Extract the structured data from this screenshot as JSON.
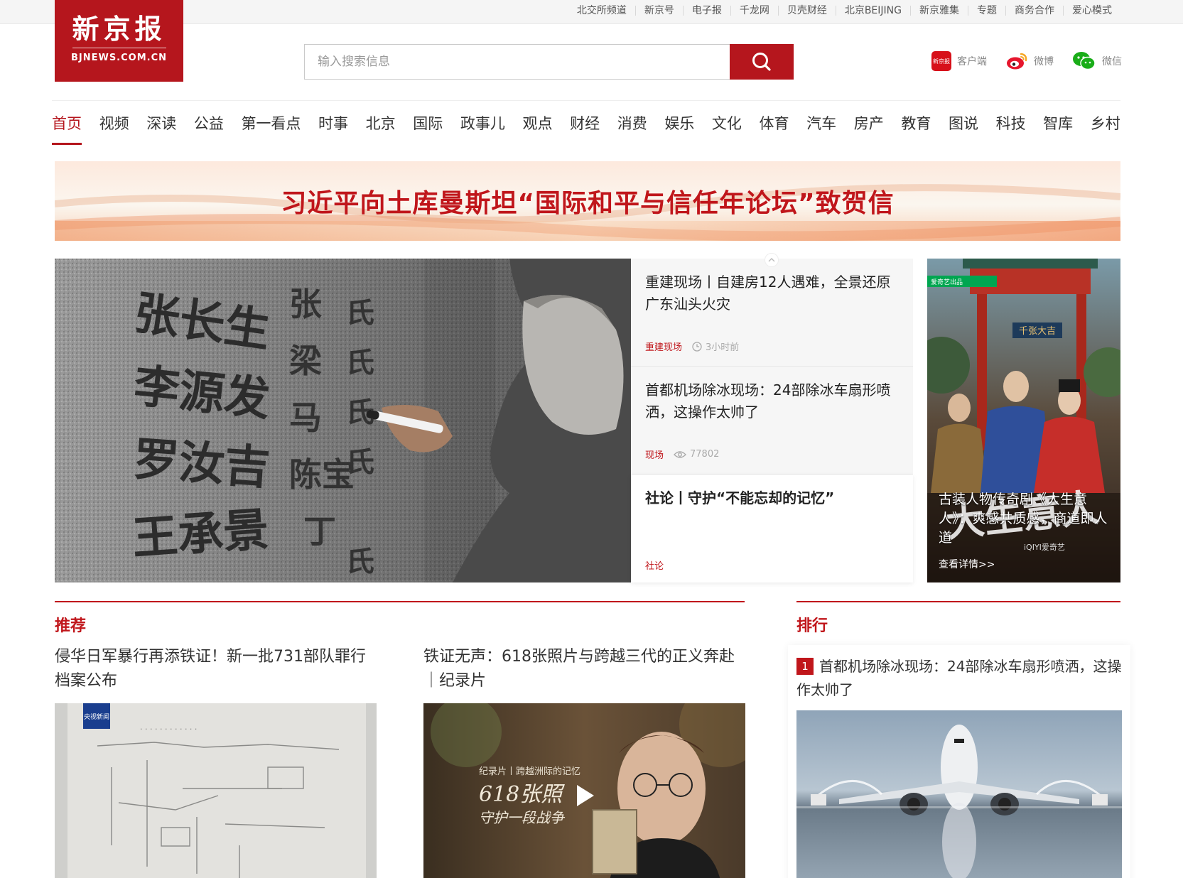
{
  "top_links": [
    "北交所频道",
    "新京号",
    "电子报",
    "千龙网",
    "贝壳财经",
    "北京BEIJING",
    "新京雅集",
    "专题",
    "商务合作",
    "爱心模式"
  ],
  "logo": {
    "cn": "新京报",
    "en": "BJNEWS.COM.CN"
  },
  "search": {
    "placeholder": "输入搜索信息"
  },
  "social": {
    "app_icon_text": "新京报",
    "app_label": "客户端",
    "weibo_label": "微博",
    "wechat_label": "微信"
  },
  "nav": [
    "首页",
    "视频",
    "深读",
    "公益",
    "第一看点",
    "时事",
    "北京",
    "国际",
    "政事儿",
    "观点",
    "财经",
    "消费",
    "娱乐",
    "文化",
    "体育",
    "汽车",
    "房产",
    "教育",
    "图说",
    "科技",
    "智库",
    "乡村"
  ],
  "banner": {
    "text": "习近平向土库曼斯坦“国际和平与信任年论坛”致贺信"
  },
  "hero": {
    "image_text": {
      "col1": [
        "张长生",
        "李源发",
        "罗汝吉",
        "王承景"
      ],
      "col2": [
        "张",
        "梁",
        "马",
        "陈宝",
        "丁"
      ],
      "col3": [
        "氏",
        "氏",
        "氏",
        "氏",
        "氏"
      ]
    },
    "items": [
      {
        "title": "重建现场丨自建房12人遇难，全景还原广东汕头火灾",
        "tag": "重建现场",
        "info": "3小时前"
      },
      {
        "title": "首都机场除冰现场：24部除冰车扇形喷洒，这操作太帅了",
        "tag": "现场",
        "info": "77802"
      },
      {
        "title": "社论丨守护“不能忘却的记忆”",
        "tag": "社论",
        "info": ""
      }
    ]
  },
  "side_poster": {
    "caption": "古装人物传奇剧《大生意人》：爽感共质感，商道即人道",
    "more": "查看详情>>",
    "badge": "爱奇艺出品",
    "plaque": "千张大吉",
    "art_title": "大生意人",
    "brand": "iQIYI爱奇艺"
  },
  "recommend": {
    "title": "推荐",
    "items": [
      {
        "title": "侵华日军暴行再添铁证！新一批731部队罪行档案公布",
        "badge": "央视新闻"
      },
      {
        "title": "铁证无声：618张照片与跨越三代的正义奔赴｜纪录片",
        "overlay_small": "纪录片丨跨越洲际的记忆",
        "overlay_big": "618张照",
        "overlay_sub": "守护一段战争"
      }
    ]
  },
  "ranking": {
    "title": "排行",
    "items": [
      {
        "num": "1",
        "title": "首都机场除冰现场：24部除冰车扇形喷洒，这操作太帅了"
      }
    ]
  },
  "colors": {
    "brand_red": "#b5161d",
    "accent_red": "#c0161b"
  }
}
